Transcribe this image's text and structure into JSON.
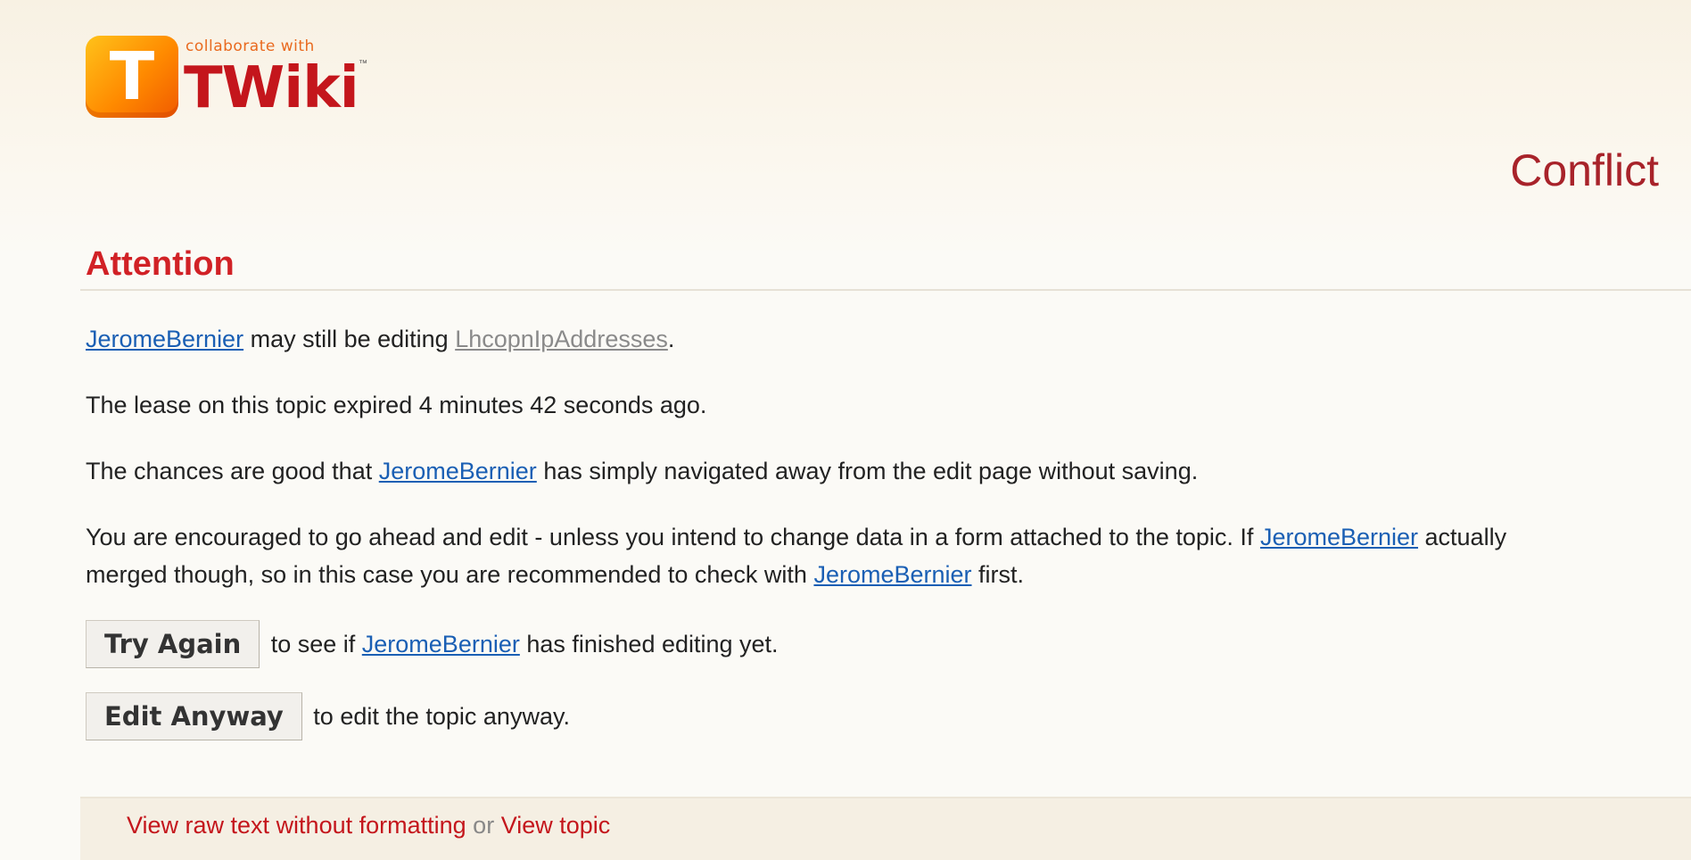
{
  "logo": {
    "letter": "T",
    "tagline": "collaborate with",
    "word": "TWiki",
    "tm": "™"
  },
  "page_title": "Conflict",
  "heading": "Attention",
  "line1": {
    "user": "JeromeBernier",
    "text": " may still be editing ",
    "topic": "LhcopnIpAddresses",
    "end": "."
  },
  "line2": "The lease on this topic expired 4 minutes 42 seconds ago.",
  "line3": {
    "pre": "The chances are good that ",
    "user": "JeromeBernier",
    "post": " has simply navigated away from the edit page without saving."
  },
  "line4": {
    "pre": "You are encouraged to go ahead and edit - unless you intend to change data in a form attached to the topic. If ",
    "user": "JeromeBernier",
    "post": " actually"
  },
  "line5": {
    "pre": "merged though, so in this case you are recommended to check with ",
    "user": "JeromeBernier",
    "post": " first."
  },
  "try_again": {
    "button": "Try Again",
    "pre": "to see if ",
    "user": "JeromeBernier",
    "post": " has finished editing yet."
  },
  "edit_anyway": {
    "button": "Edit Anyway",
    "text": "to edit the topic anyway."
  },
  "footer": {
    "raw_link": "View raw text without formatting",
    "or": " or ",
    "view_link": "View topic"
  }
}
